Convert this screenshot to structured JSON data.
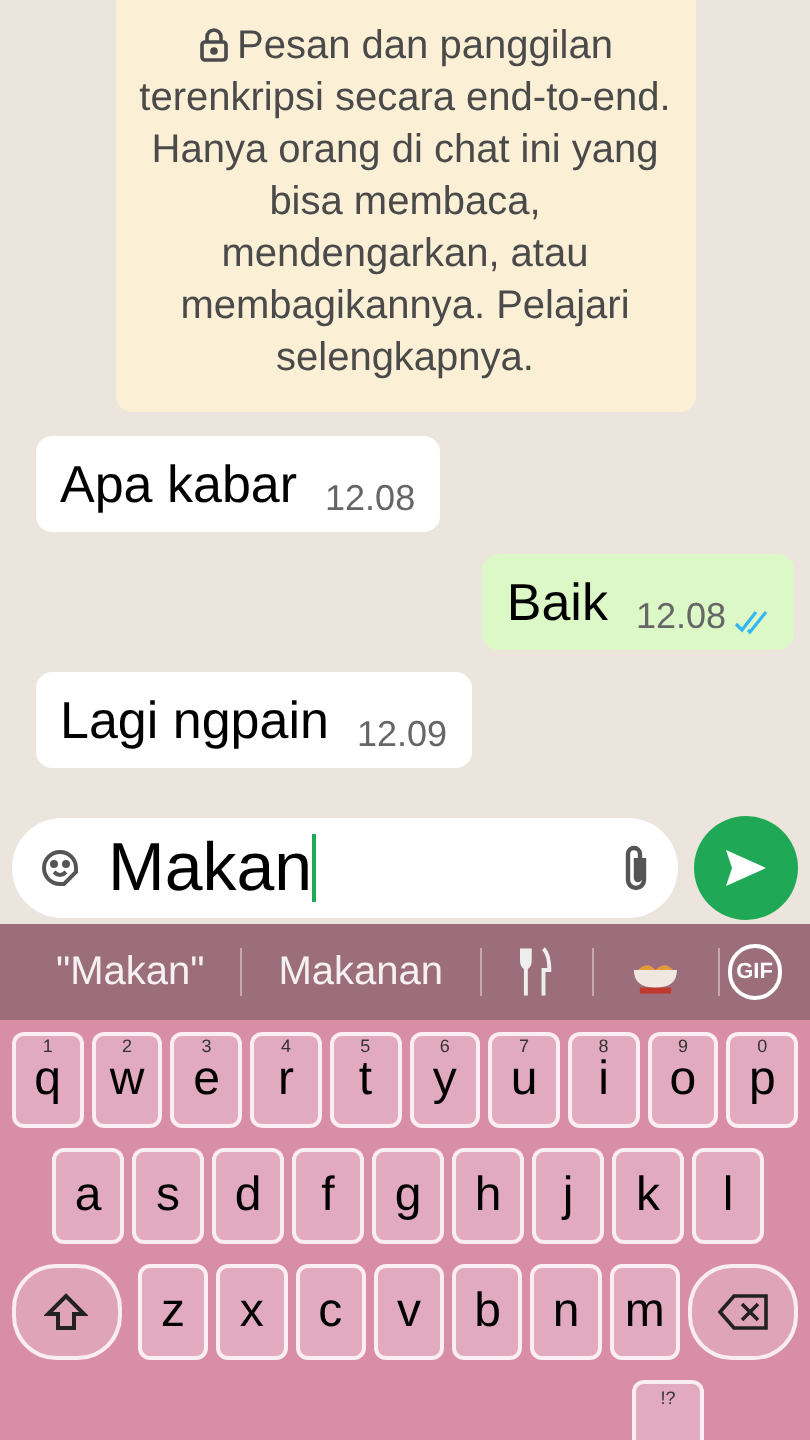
{
  "notice": {
    "text": "Pesan dan panggilan terenkripsi secara end-to-end. Hanya orang di chat ini yang bisa membaca, mendengarkan, atau membagikannya. Pelajari selengkapnya."
  },
  "messages": [
    {
      "kind": "incoming",
      "text": "Apa kabar",
      "time": "12.08"
    },
    {
      "kind": "outgoing",
      "text": "Baik",
      "time": "12.08",
      "read": true
    },
    {
      "kind": "incoming",
      "text": "Lagi ngpain",
      "time": "12.09"
    }
  ],
  "composer": {
    "value": "Makan"
  },
  "suggestions": [
    {
      "kind": "text",
      "label": "\"Makan\""
    },
    {
      "kind": "text",
      "label": "Makanan"
    },
    {
      "kind": "cutlery"
    },
    {
      "kind": "bowl"
    },
    {
      "kind": "gif",
      "label": "GIF"
    }
  ],
  "keyboard": {
    "rows": [
      [
        {
          "label": "q",
          "hint": "1"
        },
        {
          "label": "w",
          "hint": "2"
        },
        {
          "label": "e",
          "hint": "3"
        },
        {
          "label": "r",
          "hint": "4"
        },
        {
          "label": "t",
          "hint": "5"
        },
        {
          "label": "y",
          "hint": "6"
        },
        {
          "label": "u",
          "hint": "7"
        },
        {
          "label": "i",
          "hint": "8"
        },
        {
          "label": "o",
          "hint": "9"
        },
        {
          "label": "p",
          "hint": "0"
        }
      ],
      [
        {
          "label": "a"
        },
        {
          "label": "s"
        },
        {
          "label": "d"
        },
        {
          "label": "f"
        },
        {
          "label": "g"
        },
        {
          "label": "h"
        },
        {
          "label": "j"
        },
        {
          "label": "k"
        },
        {
          "label": "l"
        }
      ],
      [
        {
          "label": "z"
        },
        {
          "label": "x"
        },
        {
          "label": "c"
        },
        {
          "label": "v"
        },
        {
          "label": "b"
        },
        {
          "label": "n"
        },
        {
          "label": "m"
        }
      ]
    ],
    "bottom_hint": "!?"
  }
}
